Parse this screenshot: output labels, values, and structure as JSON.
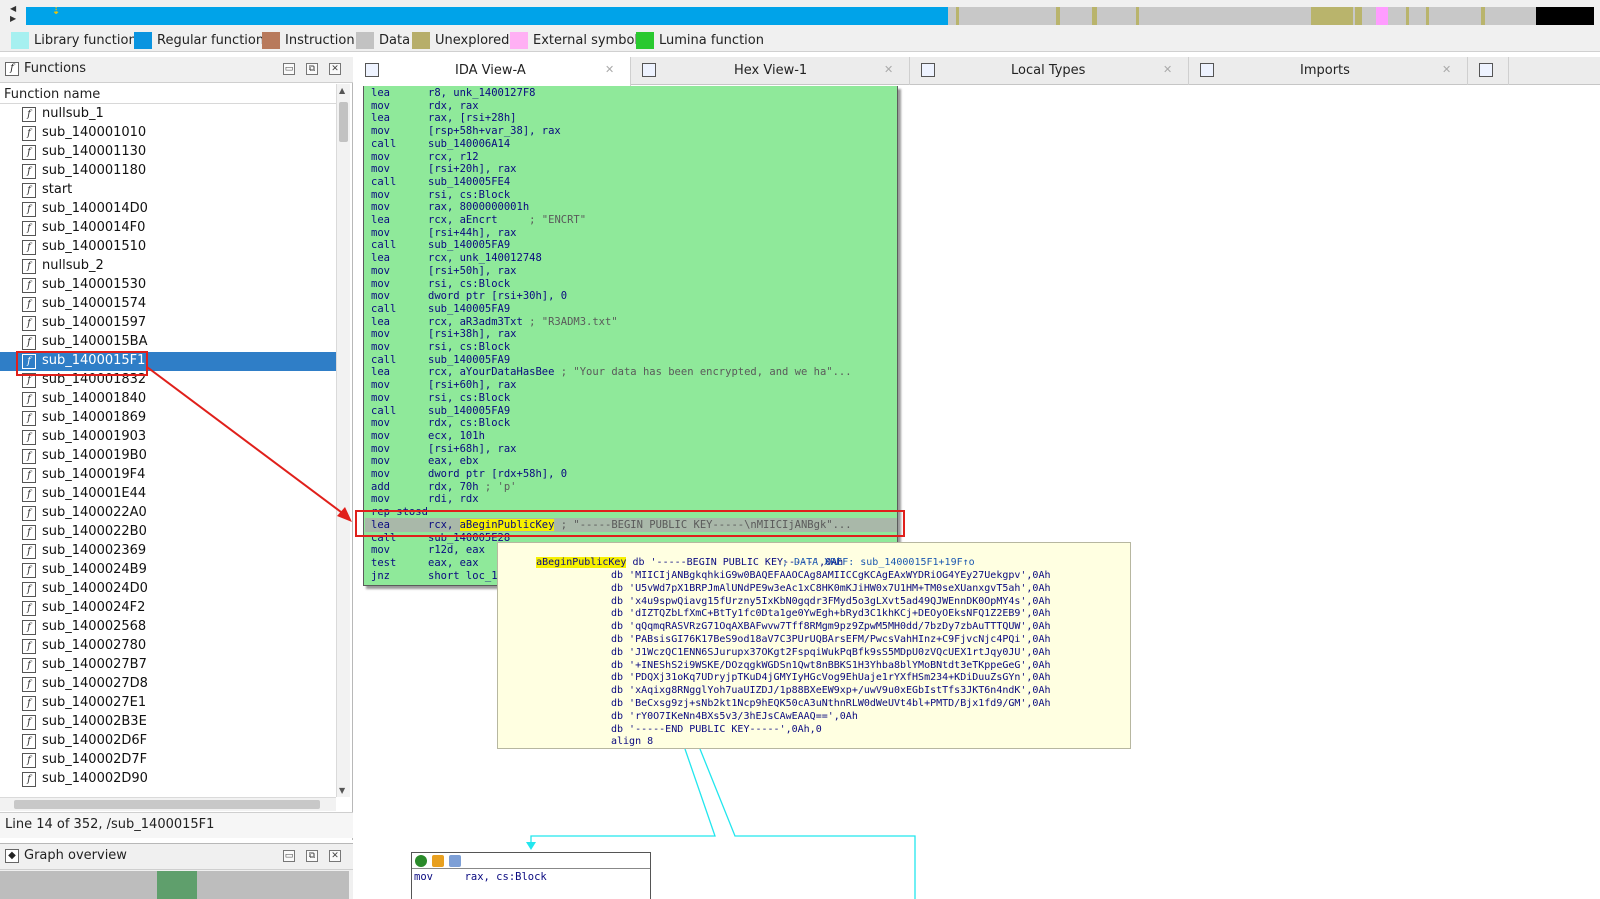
{
  "nav_band": {
    "colors": {
      "library": "#a6f0f0",
      "regular": "#00a3e9",
      "instruction": "#c08060",
      "data": "#c0c0c0",
      "unexplored": "#b9b46c",
      "external": "#ff9cff",
      "lumina": "#2ac52a",
      "black": "#000000"
    }
  },
  "legend": [
    {
      "label": "Library function",
      "color": "#a6f0f0"
    },
    {
      "label": "Regular function",
      "color": "#0a94e0"
    },
    {
      "label": "Instruction",
      "color": "#b87a5c"
    },
    {
      "label": "Data",
      "color": "#c2c2c2"
    },
    {
      "label": "Unexplored",
      "color": "#b7ae6a"
    },
    {
      "label": "External symbol",
      "color": "#ffb0f4"
    },
    {
      "label": "Lumina function",
      "color": "#29c92f"
    }
  ],
  "functions_panel": {
    "title": "Functions",
    "column_header": "Function name",
    "items": [
      "nullsub_1",
      "sub_140001010",
      "sub_140001130",
      "sub_140001180",
      "start",
      "sub_1400014D0",
      "sub_1400014F0",
      "sub_140001510",
      "nullsub_2",
      "sub_140001530",
      "sub_140001574",
      "sub_140001597",
      "sub_1400015BA",
      "sub_1400015F1",
      "sub_140001832",
      "sub_140001840",
      "sub_140001869",
      "sub_140001903",
      "sub_1400019B0",
      "sub_1400019F4",
      "sub_140001E44",
      "sub_1400022A0",
      "sub_1400022B0",
      "sub_140002369",
      "sub_1400024B9",
      "sub_1400024D0",
      "sub_1400024F2",
      "sub_140002568",
      "sub_140002780",
      "sub_1400027B7",
      "sub_1400027D8",
      "sub_1400027E1",
      "sub_140002B3E",
      "sub_140002D6F",
      "sub_140002D7F",
      "sub_140002D90"
    ],
    "selected_index": 13,
    "status": "Line 14 of 352, /sub_1400015F1"
  },
  "graph_overview": {
    "title": "Graph overview"
  },
  "tabs": [
    {
      "label": "IDA View-A",
      "active": true
    },
    {
      "label": "Hex View-1",
      "active": false
    },
    {
      "label": "Local Types",
      "active": false
    },
    {
      "label": "Imports",
      "active": false
    }
  ],
  "disasm": [
    {
      "mn": "lea",
      "op": "r8, unk_1400127F8",
      "cm": ""
    },
    {
      "mn": "mov",
      "op": "rdx, rax",
      "cm": ""
    },
    {
      "mn": "lea",
      "op": "rax, [rsi+28h]",
      "cm": ""
    },
    {
      "mn": "mov",
      "op": "[rsp+58h+var_38], rax",
      "cm": ""
    },
    {
      "mn": "call",
      "op": "sub_140006A14",
      "cm": ""
    },
    {
      "mn": "mov",
      "op": "rcx, r12",
      "cm": ""
    },
    {
      "mn": "mov",
      "op": "[rsi+20h], rax",
      "cm": ""
    },
    {
      "mn": "call",
      "op": "sub_140005FE4",
      "cm": ""
    },
    {
      "mn": "mov",
      "op": "rsi, cs:Block",
      "cm": ""
    },
    {
      "mn": "mov",
      "op": "rax, 8000000001h",
      "cm": ""
    },
    {
      "mn": "lea",
      "op": "rcx, aEncrt",
      "cm": "     ; \"ENCRT\""
    },
    {
      "mn": "mov",
      "op": "[rsi+44h], rax",
      "cm": ""
    },
    {
      "mn": "call",
      "op": "sub_140005FA9",
      "cm": ""
    },
    {
      "mn": "lea",
      "op": "rcx, unk_140012748",
      "cm": ""
    },
    {
      "mn": "mov",
      "op": "[rsi+50h], rax",
      "cm": ""
    },
    {
      "mn": "mov",
      "op": "rsi, cs:Block",
      "cm": ""
    },
    {
      "mn": "mov",
      "op": "dword ptr [rsi+30h], 0",
      "cm": ""
    },
    {
      "mn": "call",
      "op": "sub_140005FA9",
      "cm": ""
    },
    {
      "mn": "lea",
      "op": "rcx, aR3adm3Txt",
      "cm": " ; \"R3ADM3.txt\""
    },
    {
      "mn": "mov",
      "op": "[rsi+38h], rax",
      "cm": ""
    },
    {
      "mn": "mov",
      "op": "rsi, cs:Block",
      "cm": ""
    },
    {
      "mn": "call",
      "op": "sub_140005FA9",
      "cm": ""
    },
    {
      "mn": "lea",
      "op": "rcx, aYourDataHasBee",
      "cm": " ; \"Your data has been encrypted, and we ha\"..."
    },
    {
      "mn": "mov",
      "op": "[rsi+60h], rax",
      "cm": ""
    },
    {
      "mn": "mov",
      "op": "rsi, cs:Block",
      "cm": ""
    },
    {
      "mn": "call",
      "op": "sub_140005FA9",
      "cm": ""
    },
    {
      "mn": "mov",
      "op": "rdx, cs:Block",
      "cm": ""
    },
    {
      "mn": "mov",
      "op": "ecx, 101h",
      "cm": ""
    },
    {
      "mn": "mov",
      "op": "[rsi+68h], rax",
      "cm": ""
    },
    {
      "mn": "mov",
      "op": "eax, ebx",
      "cm": ""
    },
    {
      "mn": "mov",
      "op": "dword ptr [rdx+58h], 0",
      "cm": ""
    },
    {
      "mn": "add",
      "op": "rdx, 70h",
      "cm": " ; 'p'"
    },
    {
      "mn": "mov",
      "op": "rdi, rdx",
      "cm": ""
    },
    {
      "mn": "rep stosd",
      "op": "",
      "cm": ""
    },
    {
      "mn": "lea",
      "op": "rcx, aBeginPublicKey",
      "cm": " ; \"-----BEGIN PUBLIC KEY-----\\nMIICIjANBgk\"..."
    },
    {
      "mn": "call",
      "op": "sub_140005E28",
      "cm": ""
    },
    {
      "mn": "mov",
      "op": "r12d, eax",
      "cm": ""
    },
    {
      "mn": "test",
      "op": "eax, eax",
      "cm": ""
    },
    {
      "mn": "jnz",
      "op": "short loc_1",
      "cm": ""
    }
  ],
  "tooltip": {
    "label": "aBeginPublicKey",
    "first_db": "db '-----BEGIN PUBLIC KEY-----',0Ah",
    "xref": "; DATA XREF: sub_1400015F1+19F↑o",
    "lines": [
      "db 'MIICIjANBgkqhkiG9w0BAQEFAAOCAg8AMIICCgKCAgEAxWYDRiOG4YEy27Uekgpv',0Ah",
      "db 'U5vWd7pX1BRPJmAlUNdPE9w3eAc1xC8HK0mKJiHW0x7U1HM+TM0seXUanxgvT5ah',0Ah",
      "db 'x4u9spwQiavg15fUrzny5IxKbN0gqdr3FMyd5o3gLXvt5ad49QJWEnnDK0OpMY4s',0Ah",
      "db 'dIZTQZbLfXmC+BtTy1fc0Dta1ge0YwEgh+bRyd3C1khKCj+DEOyOEksNFQ1Z2EB9',0Ah",
      "db 'qQqmqRASVRzG71OqAXBAFwvw7Tff8RMgm9pz9ZpwM5MH0dd/7bzDy7zbAuTTTQUW',0Ah",
      "db 'PABsisGI76K17BeS9od18aV7C3PUrUQBArsEFM/PwcsVahHInz+C9FjvcNjc4PQi',0Ah",
      "db 'J1WczQC1ENN6SJurupx37OKgt2FspqiWukPqBfk9sS5MDpU0zVQcUEX1rtJqy0JU',0Ah",
      "db '+INEShS2i9WSKE/DOzqgkWGDSn1Qwt8nBBKS1H3Yhba8blYMoBNtdt3eTKppeGeG',0Ah",
      "db 'PDQXj31oKq7UDryjpTKuD4jGMYIyHGcVog9EhUaje1rYXfHSm234+KDiDuuZsGYn',0Ah",
      "db 'xAqixg8RNgglYoh7uaUIZDJ/1p88BXeEW9xp+/uwV9u0xEGbIstTfs3JKT6n4ndK',0Ah",
      "db 'BeCxsg9zj+sNb2kt1Ncp9hEQK50cA3uNthnRLW0dWeUVt4bl+PMTD/Bjx1fd9/GM',0Ah",
      "db 'rY0O7IKeNn4BXs5v3/3hEJsCAwEAAQ==',0Ah",
      "db '-----END PUBLIC KEY-----',0Ah,0",
      "align 8"
    ]
  },
  "small_block": {
    "code": "mov     rax, cs:Block"
  }
}
